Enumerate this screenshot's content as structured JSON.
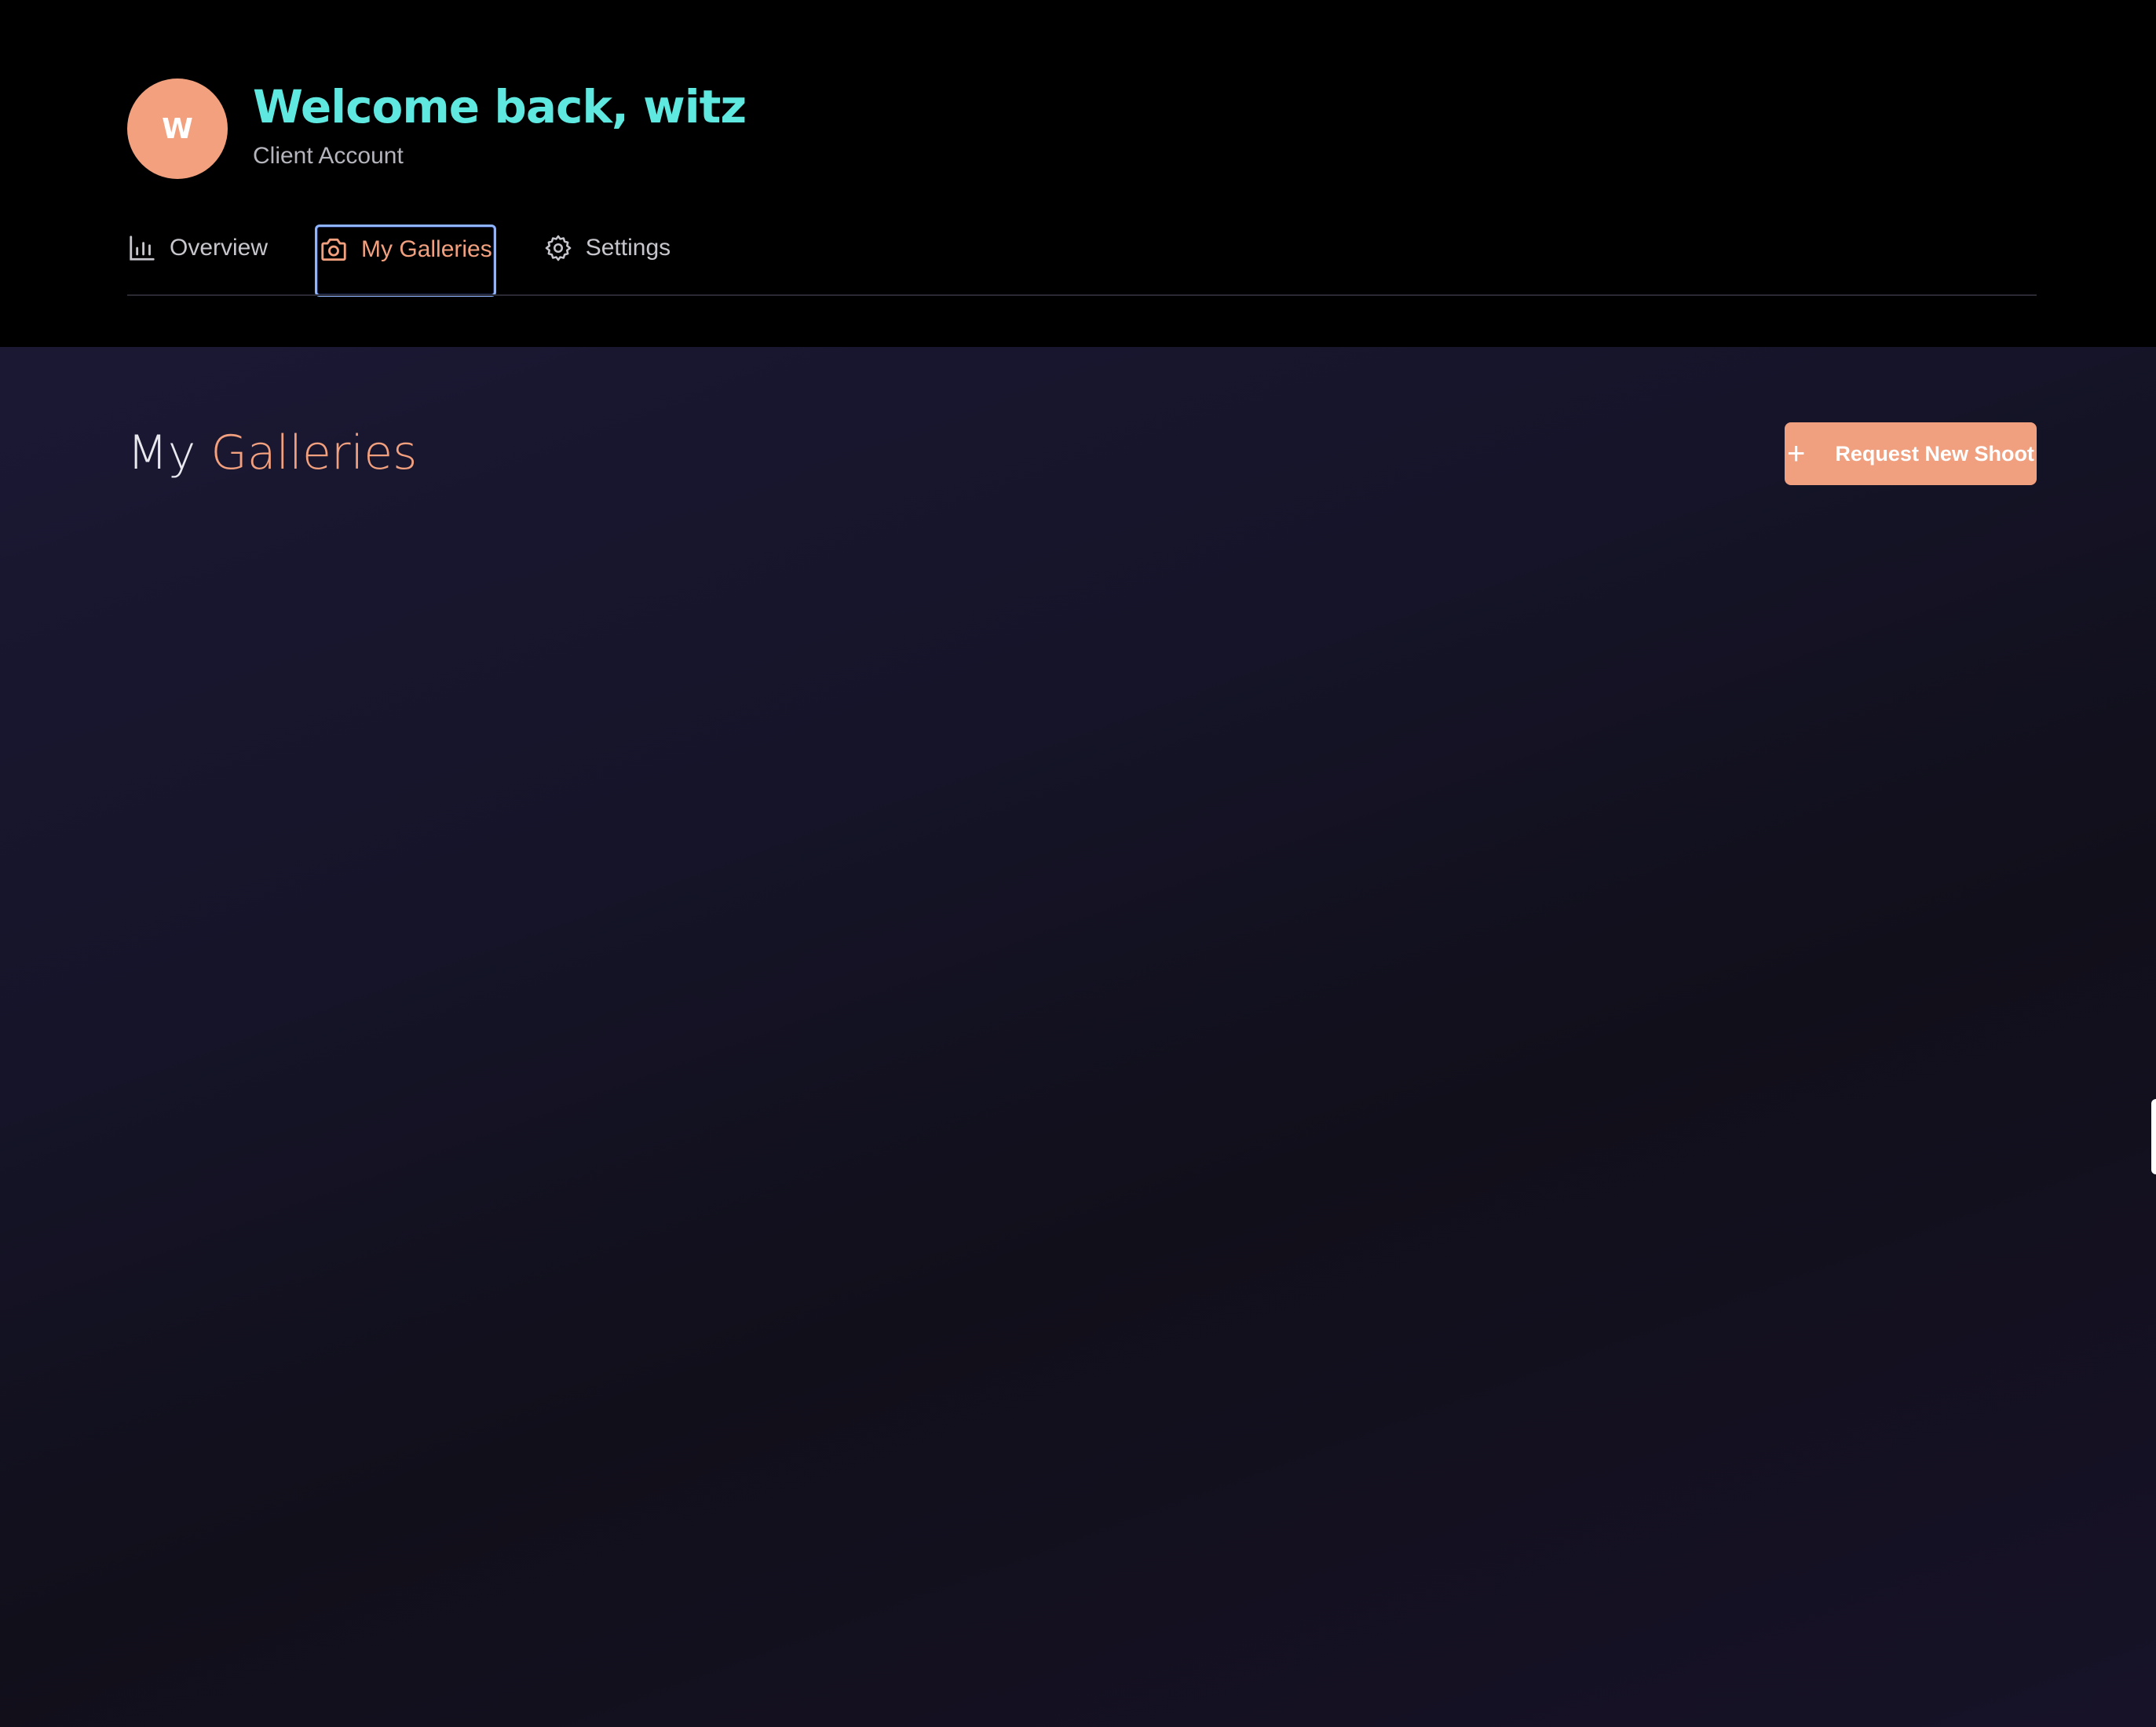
{
  "header": {
    "avatar_initial": "W",
    "welcome": "Welcome back, witz",
    "account_type": "Client Account"
  },
  "tabs": [
    {
      "label": "Overview",
      "icon": "bar-chart-icon",
      "active": false
    },
    {
      "label": "My Galleries",
      "icon": "camera-icon",
      "active": true
    },
    {
      "label": "Settings",
      "icon": "gear-icon",
      "active": false
    }
  ],
  "main": {
    "title_part1": "My",
    "title_part2": "Galleries",
    "request_button": {
      "icon": "plus-icon",
      "label": "Request New Shoot"
    }
  },
  "colors": {
    "accent": "#f2a07e",
    "welcome": "#5ee8e0",
    "focus_ring": "#8fb4ff"
  }
}
